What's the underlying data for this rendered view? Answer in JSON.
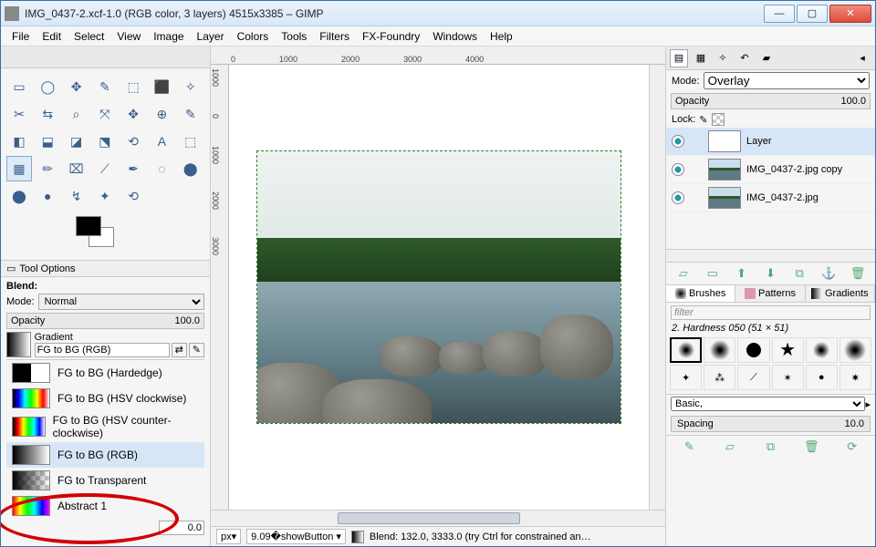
{
  "window": {
    "title": "IMG_0437-2.xcf-1.0 (RGB color, 3 layers) 4515x3385 – GIMP",
    "min": "—",
    "max": "▢",
    "close": "✕"
  },
  "menu": [
    "File",
    "Edit",
    "Select",
    "View",
    "Image",
    "Layer",
    "Colors",
    "Tools",
    "Filters",
    "FX-Foundry",
    "Windows",
    "Help"
  ],
  "ruler_h": [
    "0",
    "1000",
    "2000",
    "3000",
    "4000"
  ],
  "ruler_v": [
    "1000",
    "0",
    "1000",
    "2000",
    "3000"
  ],
  "toolbox": {
    "icons": [
      "▭",
      "◯",
      "✥",
      "✎",
      "⬚",
      "⬛",
      "✧",
      "✂",
      "⇆",
      "⌕",
      "⤧",
      "✥",
      "⊕",
      "✎",
      "◧",
      "⬓",
      "◪",
      "⬔",
      "⟲",
      "A",
      "⬚",
      "▦",
      "✏",
      "⌧",
      "⟋",
      "✒",
      "◌",
      "⬤",
      "⬤",
      "●",
      "↯",
      "✦",
      "⟲"
    ]
  },
  "tool_options": {
    "title": "Tool Options",
    "blend": "Blend:",
    "mode_label": "Mode:",
    "mode_value": "Normal",
    "opacity_label": "Opacity",
    "opacity_value": "100.0",
    "gradient_label": "Gradient",
    "gradient_name": "FG to BG (RGB)",
    "offset_value": "0.0",
    "list": [
      {
        "label": "FG to BG (Hardedge)",
        "grad": "linear-gradient(90deg,#000 50%,#fff 50%)"
      },
      {
        "label": "FG to BG (HSV clockwise)",
        "grad": "linear-gradient(90deg,#000,#00f,#0ff,#0f0,#ff0,#f00,#fff)"
      },
      {
        "label": "FG to BG (HSV counter-clockwise)",
        "grad": "linear-gradient(90deg,#000,#f00,#ff0,#0f0,#0ff,#00f,#fff)"
      },
      {
        "label": "FG to BG (RGB)",
        "grad": "linear-gradient(90deg,#000,#fff)",
        "sel": true
      },
      {
        "label": "FG to Transparent",
        "grad": "linear-gradient(90deg,#000,rgba(0,0,0,0)),repeating-conic-gradient(#ccc 0 25%,#fff 0 50%) 0/10px 10px"
      },
      {
        "label": "Abstract 1",
        "grad": "linear-gradient(90deg,#f00,#ff0,#0f0,#0ff,#00f,#f0f)"
      }
    ]
  },
  "status": {
    "unit": "px",
    "zoom": "9.09",
    "msg": "Blend: 132.0, 3333.0 (try Ctrl for constrained an…"
  },
  "layers": {
    "mode_label": "Mode:",
    "mode_value": "Overlay",
    "opacity_label": "Opacity",
    "opacity_value": "100.0",
    "lock_label": "Lock:",
    "rows": [
      {
        "name": "Layer",
        "img": false,
        "sel": true
      },
      {
        "name": "IMG_0437-2.jpg copy",
        "img": true
      },
      {
        "name": "IMG_0437-2.jpg",
        "img": true
      }
    ],
    "btns": [
      "▱",
      "▭",
      "⬆",
      "⬇",
      "⧉",
      "⚓",
      "🗑"
    ]
  },
  "brushes": {
    "tabs": [
      "Brushes",
      "Patterns",
      "Gradients"
    ],
    "filter": "filter",
    "current": "2. Hardness 050 (51 × 51)",
    "preset": "Basic,",
    "spacing_label": "Spacing",
    "spacing_value": "10.0",
    "btns": [
      "✎",
      "▱",
      "⧉",
      "🗑",
      "⟳"
    ]
  }
}
